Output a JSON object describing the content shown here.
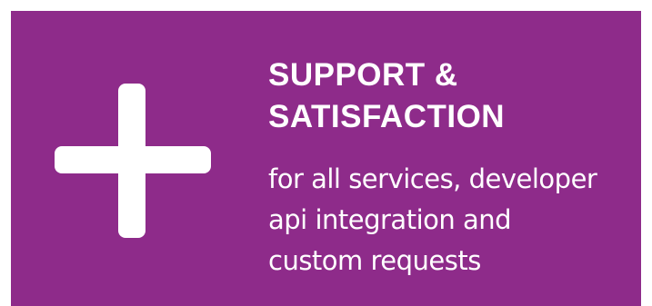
{
  "banner": {
    "background_color": "#8e2b8a",
    "icon": "plus-icon",
    "heading_lines": [
      "SUPPORT &",
      "SATISFACTION"
    ],
    "subtitle_lines": [
      "for all services, developer",
      "api integration and",
      "custom requests"
    ]
  }
}
